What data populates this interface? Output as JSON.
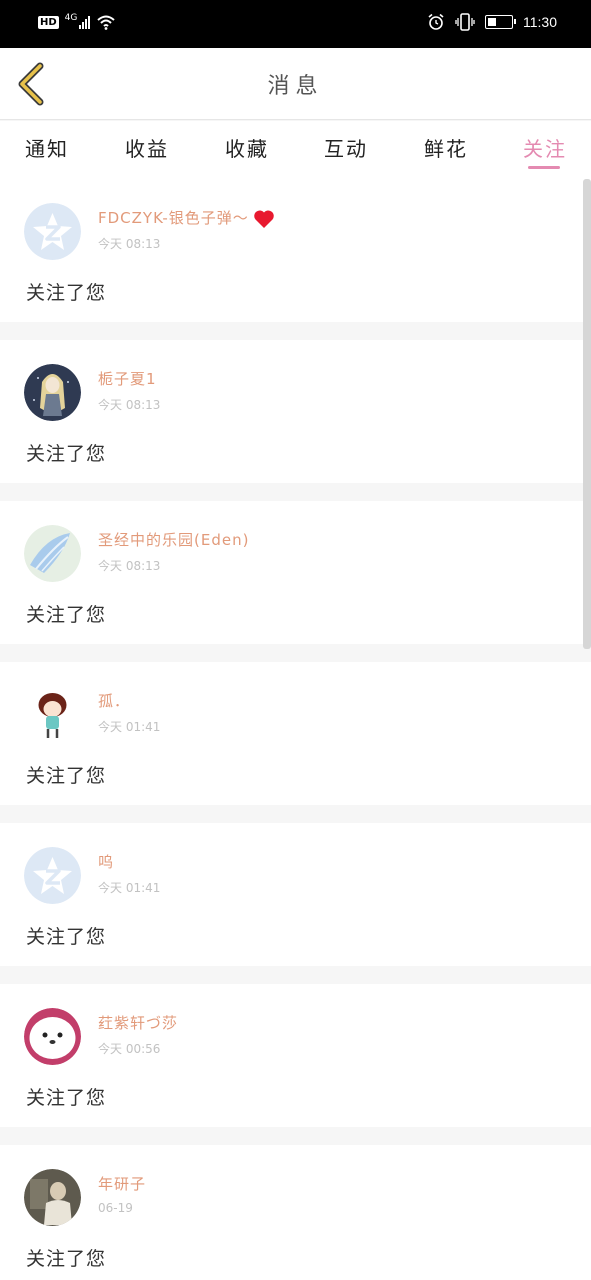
{
  "status_bar": {
    "hd_label": "HD",
    "network_label": "4G",
    "time": "11:30",
    "icons": [
      "signal-icon",
      "wifi-icon",
      "alarm-icon",
      "vibrate-icon",
      "battery-icon"
    ]
  },
  "header": {
    "title": "消息",
    "back_icon": "chevron-left-icon",
    "back_color": "#e8c24a"
  },
  "tabs": [
    {
      "label": "通知",
      "active": false
    },
    {
      "label": "收益",
      "active": false
    },
    {
      "label": "收藏",
      "active": false
    },
    {
      "label": "互动",
      "active": false
    },
    {
      "label": "鲜花",
      "active": false
    },
    {
      "label": "关注",
      "active": true
    }
  ],
  "colors": {
    "accent": "#e48ab1",
    "username": "#e29a7a",
    "timestamp": "#c2c2c2"
  },
  "notifications": [
    {
      "user": "FDCZYK-银色子弹～",
      "has_heart": true,
      "time": "今天 08:13",
      "action": "关注了您",
      "avatar": "default-z"
    },
    {
      "user": "栀子夏1",
      "has_heart": false,
      "time": "今天 08:13",
      "action": "关注了您",
      "avatar": "anime-girl"
    },
    {
      "user": "圣经中的乐园(Eden)",
      "has_heart": false,
      "time": "今天 08:13",
      "action": "关注了您",
      "avatar": "blue-wing"
    },
    {
      "user": "孤．",
      "has_heart": false,
      "time": "今天 01:41",
      "action": "关注了您",
      "avatar": "chibi-girl"
    },
    {
      "user": "呜",
      "has_heart": false,
      "time": "今天 01:41",
      "action": "关注了您",
      "avatar": "default-z"
    },
    {
      "user": "荭紫轩づ莎",
      "has_heart": false,
      "time": "今天 00:56",
      "action": "关注了您",
      "avatar": "white-bear"
    },
    {
      "user": "年研子",
      "has_heart": false,
      "time": "06-19",
      "action": "关注了您",
      "avatar": "photo"
    }
  ]
}
